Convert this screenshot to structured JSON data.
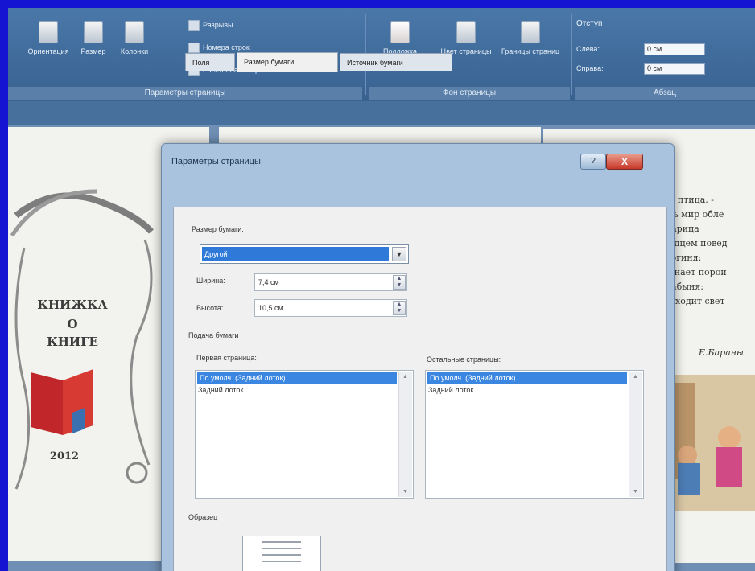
{
  "ribbon": {
    "orientation_label": "Ориентация",
    "size_label": "Размер",
    "columns_label": "Колонки",
    "breaks_label": "Разрывы",
    "line_numbers_label": "Номера строк",
    "hyphenation_label": "Расстановка переносов",
    "group_page_setup": "Параметры страницы",
    "watermark_label": "Подложка",
    "page_color_label": "Цвет страницы",
    "page_borders_label": "Границы страниц",
    "group_page_background": "Фон страницы",
    "indent_title": "Отступ",
    "indent_left_label": "Слева:",
    "indent_left_value": "0 см",
    "indent_right_label": "Справа:",
    "indent_right_value": "0 см",
    "group_paragraph": "Абзац"
  },
  "document": {
    "cover_line1": "КНИЖКА",
    "cover_line2": "О",
    "cover_line3": "КНИГЕ",
    "cover_year": "2012",
    "poem_lines": [
      "кая птица, -",
      "тесь мир обле",
      "– царица",
      "сердцем повед",
      "– богиня:",
      "вернает порой",
      "– рабыня:",
      "проходит свет"
    ],
    "author": "Е.Бараны"
  },
  "dialog": {
    "title": "Параметры страницы",
    "help_button": "?",
    "close_button": "X",
    "tabs": [
      "Поля",
      "Размер бумаги",
      "Источник бумаги"
    ],
    "paper_size_label": "Размер бумаги:",
    "paper_size_value": "Другой",
    "width_label": "Ширина:",
    "width_value": "7,4 см",
    "height_label": "Высота:",
    "height_value": "10,5 см",
    "paper_feed_label": "Подача бумаги",
    "first_page_label": "Первая страница:",
    "first_page_items": [
      "По умолч. (Задний лоток)",
      "Задний лоток"
    ],
    "other_pages_label": "Остальные страницы:",
    "other_pages_items": [
      "По умолч. (Задний лоток)",
      "Задний лоток"
    ],
    "preview_label": "Образец"
  }
}
